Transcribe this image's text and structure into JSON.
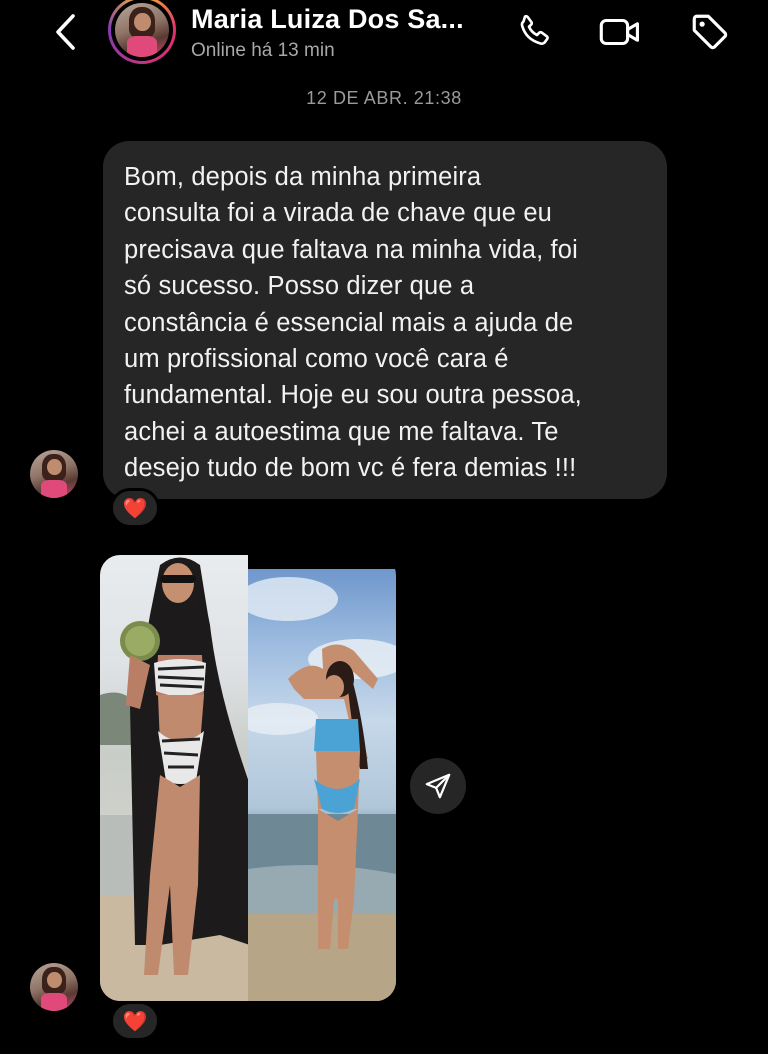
{
  "header": {
    "contact_name": "Maria Luiza Dos Sa...",
    "status": "Online há 13 min",
    "icons": {
      "back": "chevron-left-icon",
      "call": "phone-icon",
      "video": "video-camera-icon",
      "tag": "tag-icon"
    }
  },
  "thread": {
    "timestamp": "12 DE ABR. 21:38",
    "message": {
      "lines": [
        "Bom, depois da minha primeira",
        "consulta foi a virada de chave que eu",
        "precisava que faltava na minha vida, foi",
        "só sucesso. Posso dizer que a",
        "constância é essencial mais a ajuda de",
        "um profissional como você cara é",
        "fundamental. Hoje eu sou outra pessoa,",
        "achei a autoestima que me faltava. Te",
        "desejo tudo de bom vc é fera demias !!!"
      ],
      "reaction": "❤️"
    },
    "photo_message": {
      "reaction": "❤️",
      "share_icon": "send-icon"
    }
  },
  "colors": {
    "background": "#000000",
    "bubble": "#262626",
    "secondary_text": "#a8a8a8"
  }
}
